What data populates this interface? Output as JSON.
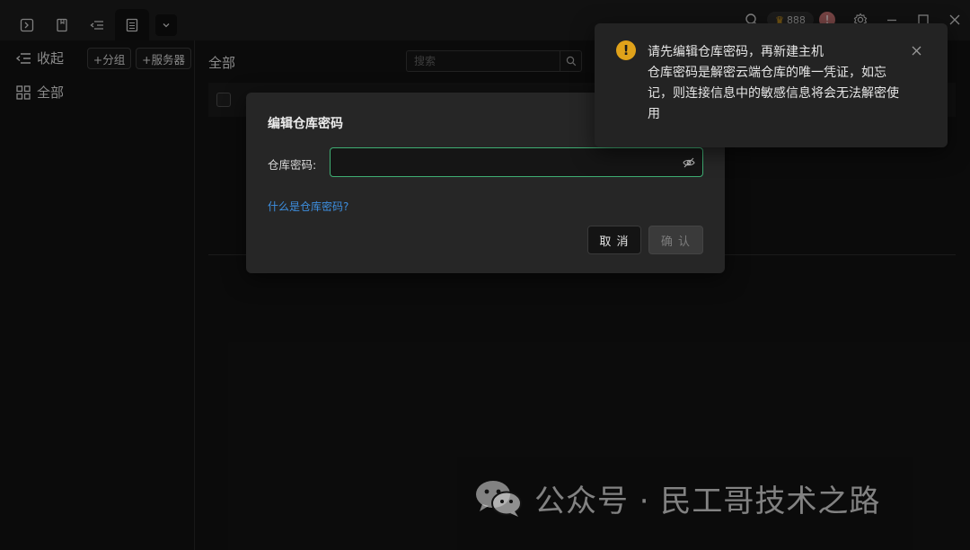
{
  "titlebar": {
    "tabs": [
      {
        "icon": "terminal-icon"
      },
      {
        "icon": "bookmark-icon"
      },
      {
        "icon": "collapse-tree-icon"
      },
      {
        "icon": "list-panel-icon",
        "active": true
      }
    ],
    "dropdown_icon": "chevron-down-icon",
    "user_badge": "888",
    "alert": "!",
    "window_controls": [
      "search-icon",
      "settings-icon",
      "minimize-icon",
      "maximize-icon",
      "close-icon"
    ]
  },
  "sidebar": {
    "collapse_label": "收起",
    "add_group_label": "+分组",
    "add_server_label": "+服务器",
    "all_label": "全部"
  },
  "main": {
    "title": "全部",
    "search_placeholder": "搜索"
  },
  "modal": {
    "title": "编辑仓库密码",
    "field_label": "仓库密码:",
    "password_value": "",
    "help_link": "什么是仓库密码?",
    "cancel_label": "取 消",
    "confirm_label": "确 认"
  },
  "notice": {
    "title": "请先编辑仓库密码，再新建主机",
    "body": "仓库密码是解密云端仓库的唯一凭证，如忘记，则连接信息中的敏感信息将会无法解密使用",
    "status_color": "#e0a21a"
  },
  "watermark": {
    "text": "公众号 · 民工哥技术之路"
  },
  "colors": {
    "accent_green": "#3fae73",
    "link_blue": "#3d8fe0",
    "warning_orange": "#e0a21a"
  }
}
